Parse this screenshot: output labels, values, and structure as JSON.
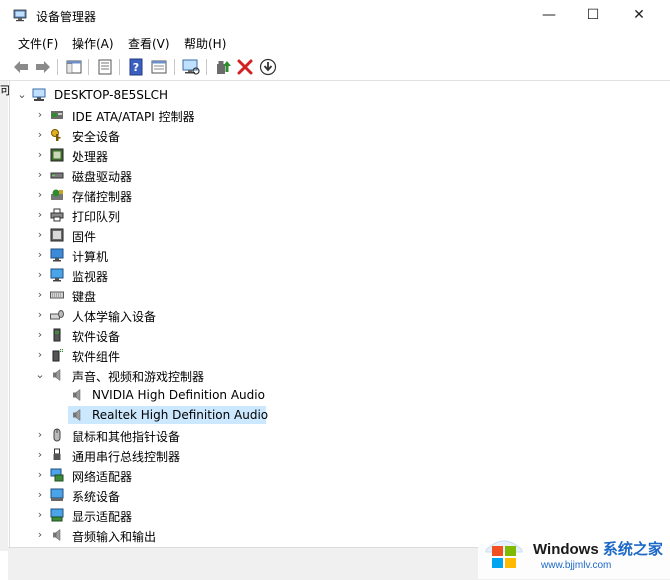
{
  "window": {
    "title": "设备管理器",
    "controls": {
      "minimize": "—",
      "maximize": "☐",
      "close": "✕"
    }
  },
  "menu": [
    "文件(F)",
    "操作(A)",
    "查看(V)",
    "帮助(H)"
  ],
  "gutter_label": "可",
  "tree": {
    "root": "DESKTOP-8E5SLCH",
    "categories": [
      {
        "label": "IDE ATA/ATAPI 控制器",
        "icon": "ide-controller-icon",
        "expanded": false
      },
      {
        "label": "安全设备",
        "icon": "security-key-icon",
        "expanded": false
      },
      {
        "label": "处理器",
        "icon": "processor-icon",
        "expanded": false
      },
      {
        "label": "磁盘驱动器",
        "icon": "disk-drive-icon",
        "expanded": false
      },
      {
        "label": "存储控制器",
        "icon": "storage-controller-icon",
        "expanded": false
      },
      {
        "label": "打印队列",
        "icon": "printer-icon",
        "expanded": false
      },
      {
        "label": "固件",
        "icon": "firmware-icon",
        "expanded": false
      },
      {
        "label": "计算机",
        "icon": "computer-icon",
        "expanded": false
      },
      {
        "label": "监视器",
        "icon": "monitor-icon",
        "expanded": false
      },
      {
        "label": "键盘",
        "icon": "keyboard-icon",
        "expanded": false
      },
      {
        "label": "人体学输入设备",
        "icon": "hid-icon",
        "expanded": false
      },
      {
        "label": "软件设备",
        "icon": "software-device-icon",
        "expanded": false
      },
      {
        "label": "软件组件",
        "icon": "software-component-icon",
        "expanded": false
      },
      {
        "label": "声音、视频和游戏控制器",
        "icon": "speaker-icon",
        "expanded": true,
        "children": [
          {
            "label": "NVIDIA High Definition Audio",
            "icon": "speaker-icon",
            "selected": false
          },
          {
            "label": "Realtek High Definition Audio",
            "icon": "speaker-icon",
            "selected": true
          }
        ]
      },
      {
        "label": "鼠标和其他指针设备",
        "icon": "mouse-icon",
        "expanded": false
      },
      {
        "label": "通用串行总线控制器",
        "icon": "usb-icon",
        "expanded": false
      },
      {
        "label": "网络适配器",
        "icon": "network-adapter-icon",
        "expanded": false
      },
      {
        "label": "系统设备",
        "icon": "system-device-icon",
        "expanded": false
      },
      {
        "label": "显示适配器",
        "icon": "display-adapter-icon",
        "expanded": false
      },
      {
        "label": "音频输入和输出",
        "icon": "audio-io-icon",
        "expanded": false
      }
    ]
  },
  "watermark": {
    "brand": "Windows",
    "cn": "系统之家",
    "url": "www.bjjmlv.com"
  },
  "colors": {
    "selection": "#cce8ff",
    "accent": "#1c68c7",
    "remove_red": "#d32020",
    "update_green": "#2e8b2e"
  }
}
